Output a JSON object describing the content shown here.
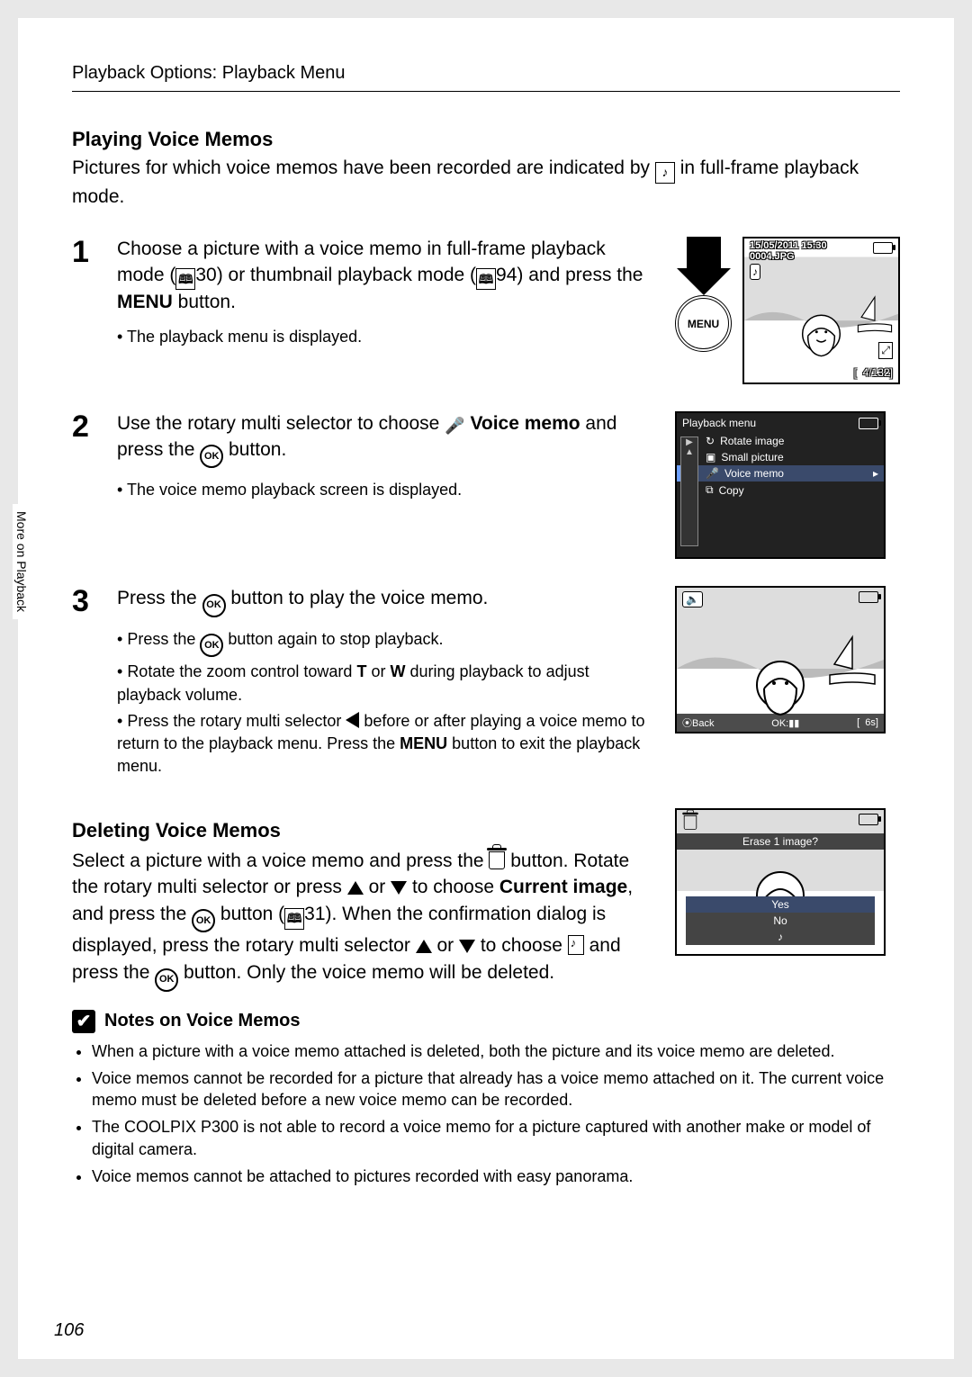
{
  "header": "Playback Options: Playback Menu",
  "side_tab": "More on Playback",
  "page_number": "106",
  "section1": {
    "title": "Playing Voice Memos",
    "intro_pre": "Pictures for which voice memos have been recorded are indicated by ",
    "intro_post": " in full-frame playback mode."
  },
  "step1": {
    "num": "1",
    "line1_a": "Choose a picture with a voice memo in full-frame playback mode (",
    "ref1": "30",
    "line1_b": ") or thumbnail playback mode (",
    "ref2": "94",
    "line1_c": ") and press the ",
    "menuword": "MENU",
    "line1_d": " button.",
    "bullet": "The playback menu is displayed.",
    "lcd": {
      "date": "15/05/2011 15:30",
      "file": "0004.JPG",
      "counter": "4/132"
    },
    "menu_btn_label": "MENU"
  },
  "step2": {
    "num": "2",
    "line_a": "Use the rotary multi selector to choose ",
    "line_b_strong": "Voice memo",
    "line_c": " and press the ",
    "line_d": " button.",
    "bullet": "The voice memo playback screen is displayed.",
    "lcd": {
      "title": "Playback menu",
      "items": [
        "Rotate image",
        "Small picture",
        "Voice memo",
        "Copy"
      ],
      "selected": 2
    },
    "ok_label": "OK"
  },
  "step3": {
    "num": "3",
    "line_a": "Press the ",
    "line_b": " button to play the voice memo.",
    "bullets": {
      "b1_a": "Press the ",
      "b1_b": " button again to stop playback.",
      "b2_a": "Rotate the zoom control toward ",
      "b2_T": "T",
      "b2_mid": " or ",
      "b2_W": "W",
      "b2_b": " during playback to adjust playback volume.",
      "b3_a": "Press the rotary multi selector ",
      "b3_b": " before or after playing a voice memo to return to the playback menu. Press the ",
      "b3_menu": "MENU",
      "b3_c": " button to exit the playback menu."
    },
    "lcd": {
      "back": "Back",
      "time": "6s"
    }
  },
  "section2": {
    "title": "Deleting Voice Memos",
    "p_a": "Select a picture with a voice memo and press the ",
    "p_b": " button. Rotate the rotary multi selector or press ",
    "p_c": " or ",
    "p_d": " to choose ",
    "current": "Current image",
    "p_e": ", and press the ",
    "p_f": " button (",
    "ref": "31",
    "p_g": "). When the confirmation dialog is displayed, press the rotary multi selector ",
    "p_h": " or ",
    "p_i": " to choose ",
    "p_j": " and press the ",
    "p_k": " button. Only the voice memo will be deleted.",
    "lcd": {
      "prompt": "Erase 1 image?",
      "yes": "Yes",
      "no": "No"
    }
  },
  "notes": {
    "title": "Notes on Voice Memos",
    "items": [
      "When a picture with a voice memo attached is deleted, both the picture and its voice memo are deleted.",
      "Voice memos cannot be recorded for a picture that already has a voice memo attached on it. The current voice memo must be deleted before a new voice memo can be recorded.",
      "The COOLPIX P300 is not able to record a voice memo for a picture captured with another make or model of digital camera.",
      "Voice memos cannot be attached to pictures recorded with easy panorama."
    ]
  }
}
